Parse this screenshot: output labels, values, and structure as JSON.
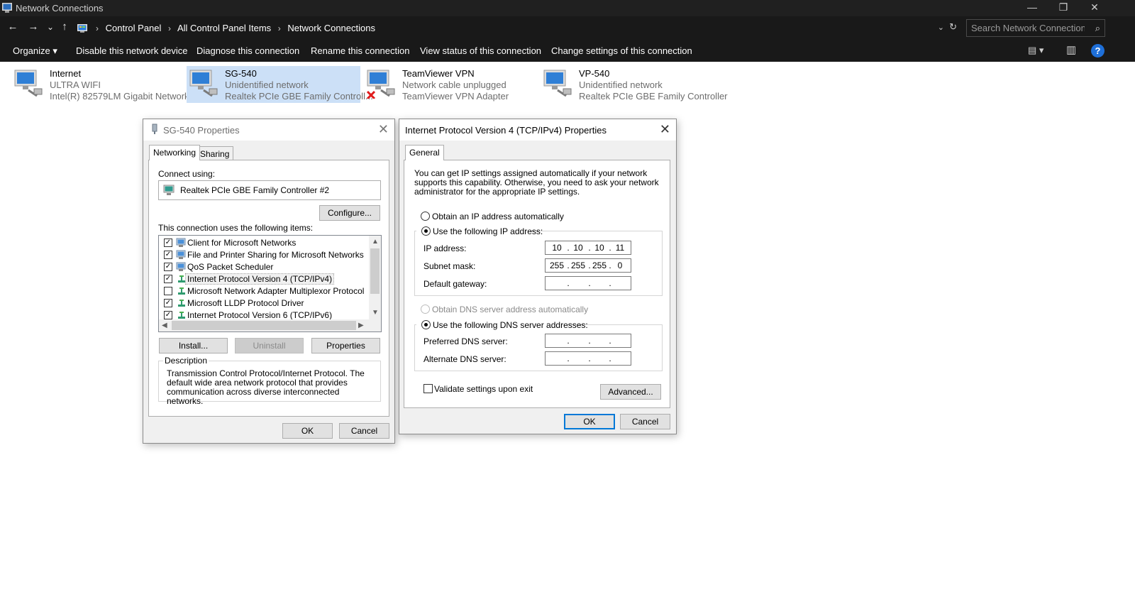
{
  "window": {
    "title": "Network Connections"
  },
  "window_controls": {
    "minimize": "—",
    "restore": "❐",
    "close": "✕"
  },
  "nav": {
    "back": "←",
    "forward": "→",
    "recent": "⌄",
    "up": "↑"
  },
  "breadcrumbs": [
    "Control Panel",
    "All Control Panel Items",
    "Network Connections"
  ],
  "address": {
    "dropdown": "⌄",
    "refresh": "↻"
  },
  "search": {
    "placeholder": "Search Network Connections",
    "icon": "⌕"
  },
  "commands": {
    "organize": "Organize ▾",
    "disable": "Disable this network device",
    "diagnose": "Diagnose this connection",
    "rename": "Rename this connection",
    "view_status": "View status of this connection",
    "change_settings": "Change settings of this connection",
    "view_options": "▤  ▾",
    "pane": "▥",
    "help": "?"
  },
  "connections": [
    {
      "name": "Internet",
      "status": "ULTRA WIFI",
      "device": "Intel(R) 82579LM Gigabit Network...",
      "selected": false,
      "disconnected": false
    },
    {
      "name": "SG-540",
      "status": "Unidentified network",
      "device": "Realtek PCIe GBE Family Controll...",
      "selected": true,
      "disconnected": false
    },
    {
      "name": "TeamViewer VPN",
      "status": "Network cable unplugged",
      "device": "TeamViewer VPN Adapter",
      "selected": false,
      "disconnected": true
    },
    {
      "name": "VP-540",
      "status": "Unidentified network",
      "device": "Realtek PCIe GBE Family Controller",
      "selected": false,
      "disconnected": false
    }
  ],
  "props": {
    "title": "SG-540 Properties",
    "close": "✕",
    "tabs": [
      "Networking",
      "Sharing"
    ],
    "connect_using_label": "Connect using:",
    "device": "Realtek PCIe GBE Family Controller #2",
    "configure": "Configure...",
    "items_label": "This connection uses the following items:",
    "items": [
      {
        "label": "Client for Microsoft Networks",
        "checked": "✓",
        "icon": "client-icon"
      },
      {
        "label": "File and Printer Sharing for Microsoft Networks",
        "checked": "✓",
        "icon": "sharing-icon"
      },
      {
        "label": "QoS Packet Scheduler",
        "checked": "✓",
        "icon": "qos-icon"
      },
      {
        "label": "Internet Protocol Version 4 (TCP/IPv4)",
        "checked": "✓",
        "icon": "protocol-icon"
      },
      {
        "label": "Microsoft Network Adapter Multiplexor Protocol",
        "checked": "",
        "icon": "protocol-icon"
      },
      {
        "label": "Microsoft LLDP Protocol Driver",
        "checked": "✓",
        "icon": "protocol-icon"
      },
      {
        "label": "Internet Protocol Version 6 (TCP/IPv6)",
        "checked": "✓",
        "icon": "protocol-icon"
      }
    ],
    "scroll": {
      "up": "▲",
      "down": "▼",
      "left": "◀",
      "right": "▶"
    },
    "install": "Install...",
    "uninstall": "Uninstall",
    "properties": "Properties",
    "description_title": "Description",
    "description": "Transmission Control Protocol/Internet Protocol. The default wide area network protocol that provides communication across diverse interconnected networks.",
    "ok": "OK",
    "cancel": "Cancel"
  },
  "ipv4": {
    "title": "Internet Protocol Version 4 (TCP/IPv4) Properties",
    "close": "✕",
    "tab": "General",
    "intro": "You can get IP settings assigned automatically if your network supports this capability. Otherwise, you need to ask your network administrator for the appropriate IP settings.",
    "auto_ip": "Obtain an IP address automatically",
    "manual_ip": "Use the following IP address:",
    "ip_label": "IP address:",
    "ip": [
      "10",
      "10",
      "10",
      "11"
    ],
    "mask_label": "Subnet mask:",
    "mask": [
      "255",
      "255",
      "255",
      "0"
    ],
    "gateway_label": "Default gateway:",
    "gateway": [
      "",
      "",
      "",
      ""
    ],
    "auto_dns": "Obtain DNS server address automatically",
    "manual_dns": "Use the following DNS server addresses:",
    "pref_dns_label": "Preferred DNS server:",
    "pref_dns": [
      "",
      "",
      "",
      ""
    ],
    "alt_dns_label": "Alternate DNS server:",
    "alt_dns": [
      "",
      "",
      "",
      ""
    ],
    "validate": "Validate settings upon exit",
    "advanced": "Advanced...",
    "ok": "OK",
    "cancel": "Cancel"
  }
}
